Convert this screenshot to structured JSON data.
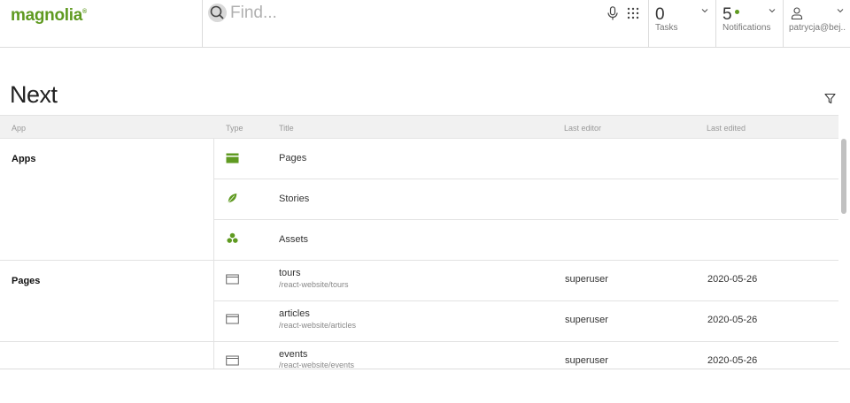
{
  "brand": {
    "logo_text": "magnolia",
    "accent": "#5f9a21"
  },
  "search": {
    "placeholder": "Find...",
    "value": ""
  },
  "header": {
    "tasks": {
      "count": "0",
      "label": "Tasks"
    },
    "notifications": {
      "count": "5",
      "label": "Notifications"
    },
    "user": {
      "name": "patrycja@bej..."
    }
  },
  "page": {
    "title": "Next"
  },
  "table": {
    "columns": {
      "app": "App",
      "type": "Type",
      "title": "Title",
      "last_editor": "Last editor",
      "last_edited": "Last edited"
    },
    "groups": [
      {
        "label": "Apps"
      },
      {
        "label": "Pages"
      }
    ],
    "rows": [
      {
        "type_icon": "pages-app-icon",
        "title": "Pages",
        "path": "",
        "editor": "",
        "edited": ""
      },
      {
        "type_icon": "stories-leaf-icon",
        "title": "Stories",
        "path": "",
        "editor": "",
        "edited": ""
      },
      {
        "type_icon": "assets-icon",
        "title": "Assets",
        "path": "",
        "editor": "",
        "edited": ""
      },
      {
        "type_icon": "page-icon",
        "title": "tours",
        "path": "/react-website/tours",
        "editor": "superuser",
        "edited": "2020-05-26"
      },
      {
        "type_icon": "page-icon",
        "title": "articles",
        "path": "/react-website/articles",
        "editor": "superuser",
        "edited": "2020-05-26"
      },
      {
        "type_icon": "page-icon",
        "title": "events",
        "path": "/react-website/events",
        "editor": "superuser",
        "edited": "2020-05-26"
      }
    ]
  }
}
